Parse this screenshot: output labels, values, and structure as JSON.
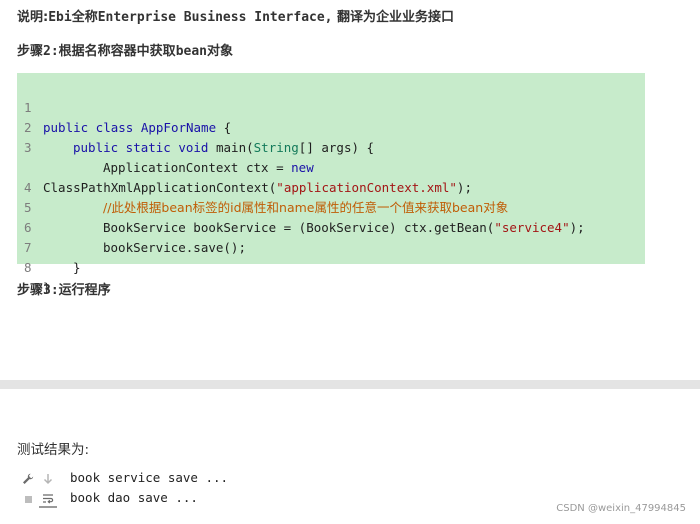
{
  "note": {
    "prefix": "说明:",
    "ebi": "Ebi",
    "full_name_label": "全称",
    "english": "Enterprise Business Interface,",
    "translation": " 翻译为企业业务接口"
  },
  "step2": {
    "prefix": "步骤",
    "num": "2:",
    "text": "根据名称容器中获取",
    "bean": "bean",
    "suffix": "对象"
  },
  "code_lines": [
    {
      "num": "1"
    },
    {
      "num": "2"
    },
    {
      "num": "3"
    },
    {
      "num": ""
    },
    {
      "num": "4"
    },
    {
      "num": "5"
    },
    {
      "num": "6"
    },
    {
      "num": "7"
    },
    {
      "num": "8"
    }
  ],
  "code": {
    "l1_kw": "public class ",
    "l1_cls": "AppForName",
    "l1_rest": " {",
    "l2_kw": "public static void ",
    "l2_main": "main(",
    "l2_type": "String",
    "l2_rest": "[] args) {",
    "l3_a": "ApplicationContext ctx = ",
    "l3_new": "new",
    "l3b_a": "ClassPathXmlApplicationContext(",
    "l3b_str": "\"applicationContext.xml\"",
    "l3b_end": ");",
    "l4_comment": "//此处根据bean标签的id属性和name属性的任意一个值来获取bean对象",
    "l5_a": "BookService bookService = (BookService) ctx.getBean(",
    "l5_str": "\"service4\"",
    "l5_end": ");",
    "l6": "bookService.save();",
    "l7": "}",
    "l8": "}"
  },
  "step3": {
    "prefix": "步骤",
    "num": "3:",
    "text": "运行程序"
  },
  "result_label": "测试结果为:",
  "console_output": [
    "book service save ...",
    "book dao save ..."
  ],
  "watermark": "CSDN @weixin_47994845",
  "icons": [
    "wrench-icon",
    "scroll-down-icon",
    "stop-icon",
    "soft-wrap-icon"
  ]
}
